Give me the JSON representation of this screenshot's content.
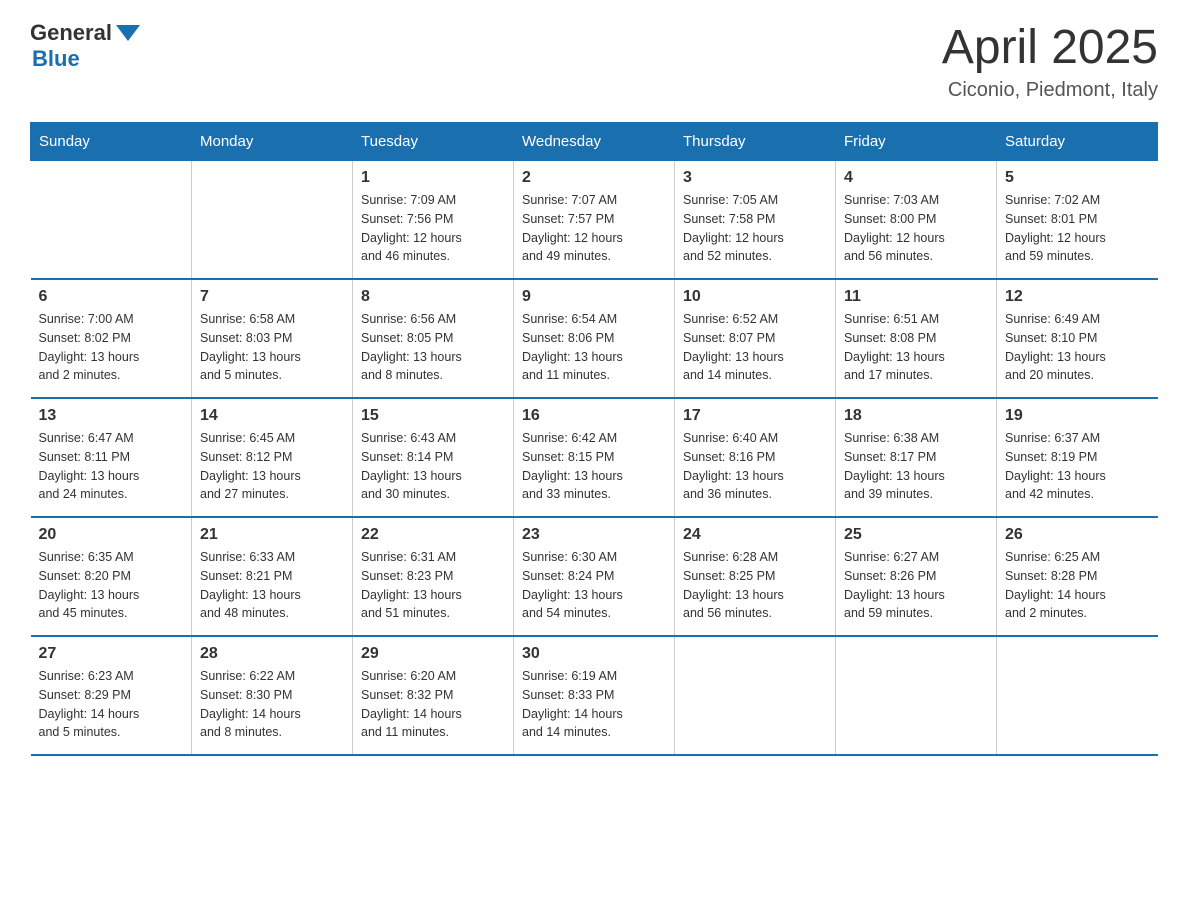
{
  "header": {
    "logo_general": "General",
    "logo_blue": "Blue",
    "month_title": "April 2025",
    "location": "Ciconio, Piedmont, Italy"
  },
  "days_of_week": [
    "Sunday",
    "Monday",
    "Tuesday",
    "Wednesday",
    "Thursday",
    "Friday",
    "Saturday"
  ],
  "weeks": [
    [
      {
        "day": "",
        "info": ""
      },
      {
        "day": "",
        "info": ""
      },
      {
        "day": "1",
        "info": "Sunrise: 7:09 AM\nSunset: 7:56 PM\nDaylight: 12 hours\nand 46 minutes."
      },
      {
        "day": "2",
        "info": "Sunrise: 7:07 AM\nSunset: 7:57 PM\nDaylight: 12 hours\nand 49 minutes."
      },
      {
        "day": "3",
        "info": "Sunrise: 7:05 AM\nSunset: 7:58 PM\nDaylight: 12 hours\nand 52 minutes."
      },
      {
        "day": "4",
        "info": "Sunrise: 7:03 AM\nSunset: 8:00 PM\nDaylight: 12 hours\nand 56 minutes."
      },
      {
        "day": "5",
        "info": "Sunrise: 7:02 AM\nSunset: 8:01 PM\nDaylight: 12 hours\nand 59 minutes."
      }
    ],
    [
      {
        "day": "6",
        "info": "Sunrise: 7:00 AM\nSunset: 8:02 PM\nDaylight: 13 hours\nand 2 minutes."
      },
      {
        "day": "7",
        "info": "Sunrise: 6:58 AM\nSunset: 8:03 PM\nDaylight: 13 hours\nand 5 minutes."
      },
      {
        "day": "8",
        "info": "Sunrise: 6:56 AM\nSunset: 8:05 PM\nDaylight: 13 hours\nand 8 minutes."
      },
      {
        "day": "9",
        "info": "Sunrise: 6:54 AM\nSunset: 8:06 PM\nDaylight: 13 hours\nand 11 minutes."
      },
      {
        "day": "10",
        "info": "Sunrise: 6:52 AM\nSunset: 8:07 PM\nDaylight: 13 hours\nand 14 minutes."
      },
      {
        "day": "11",
        "info": "Sunrise: 6:51 AM\nSunset: 8:08 PM\nDaylight: 13 hours\nand 17 minutes."
      },
      {
        "day": "12",
        "info": "Sunrise: 6:49 AM\nSunset: 8:10 PM\nDaylight: 13 hours\nand 20 minutes."
      }
    ],
    [
      {
        "day": "13",
        "info": "Sunrise: 6:47 AM\nSunset: 8:11 PM\nDaylight: 13 hours\nand 24 minutes."
      },
      {
        "day": "14",
        "info": "Sunrise: 6:45 AM\nSunset: 8:12 PM\nDaylight: 13 hours\nand 27 minutes."
      },
      {
        "day": "15",
        "info": "Sunrise: 6:43 AM\nSunset: 8:14 PM\nDaylight: 13 hours\nand 30 minutes."
      },
      {
        "day": "16",
        "info": "Sunrise: 6:42 AM\nSunset: 8:15 PM\nDaylight: 13 hours\nand 33 minutes."
      },
      {
        "day": "17",
        "info": "Sunrise: 6:40 AM\nSunset: 8:16 PM\nDaylight: 13 hours\nand 36 minutes."
      },
      {
        "day": "18",
        "info": "Sunrise: 6:38 AM\nSunset: 8:17 PM\nDaylight: 13 hours\nand 39 minutes."
      },
      {
        "day": "19",
        "info": "Sunrise: 6:37 AM\nSunset: 8:19 PM\nDaylight: 13 hours\nand 42 minutes."
      }
    ],
    [
      {
        "day": "20",
        "info": "Sunrise: 6:35 AM\nSunset: 8:20 PM\nDaylight: 13 hours\nand 45 minutes."
      },
      {
        "day": "21",
        "info": "Sunrise: 6:33 AM\nSunset: 8:21 PM\nDaylight: 13 hours\nand 48 minutes."
      },
      {
        "day": "22",
        "info": "Sunrise: 6:31 AM\nSunset: 8:23 PM\nDaylight: 13 hours\nand 51 minutes."
      },
      {
        "day": "23",
        "info": "Sunrise: 6:30 AM\nSunset: 8:24 PM\nDaylight: 13 hours\nand 54 minutes."
      },
      {
        "day": "24",
        "info": "Sunrise: 6:28 AM\nSunset: 8:25 PM\nDaylight: 13 hours\nand 56 minutes."
      },
      {
        "day": "25",
        "info": "Sunrise: 6:27 AM\nSunset: 8:26 PM\nDaylight: 13 hours\nand 59 minutes."
      },
      {
        "day": "26",
        "info": "Sunrise: 6:25 AM\nSunset: 8:28 PM\nDaylight: 14 hours\nand 2 minutes."
      }
    ],
    [
      {
        "day": "27",
        "info": "Sunrise: 6:23 AM\nSunset: 8:29 PM\nDaylight: 14 hours\nand 5 minutes."
      },
      {
        "day": "28",
        "info": "Sunrise: 6:22 AM\nSunset: 8:30 PM\nDaylight: 14 hours\nand 8 minutes."
      },
      {
        "day": "29",
        "info": "Sunrise: 6:20 AM\nSunset: 8:32 PM\nDaylight: 14 hours\nand 11 minutes."
      },
      {
        "day": "30",
        "info": "Sunrise: 6:19 AM\nSunset: 8:33 PM\nDaylight: 14 hours\nand 14 minutes."
      },
      {
        "day": "",
        "info": ""
      },
      {
        "day": "",
        "info": ""
      },
      {
        "day": "",
        "info": ""
      }
    ]
  ]
}
